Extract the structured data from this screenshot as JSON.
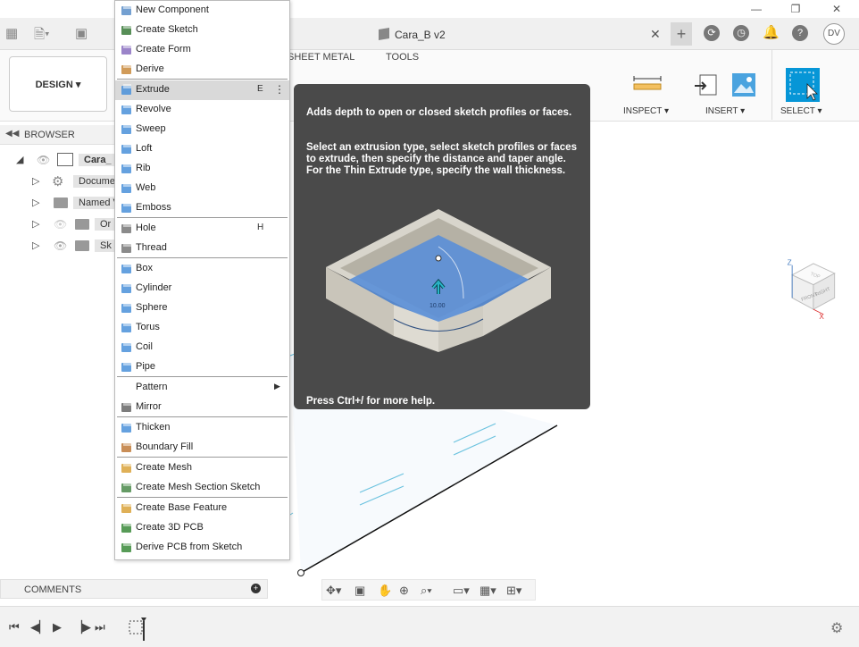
{
  "window": {
    "controls": [
      "—",
      "❐",
      "✕"
    ]
  },
  "app_bar": {
    "document_title": "Cara_B v2",
    "user_initials": "DV",
    "close_tab": "✕"
  },
  "toolbar": {
    "workspace_label": "DESIGN ▾",
    "tabs": [
      "SHEET METAL",
      "TOOLS"
    ],
    "groups": {
      "inspect": "INSPECT ▾",
      "insert": "INSERT ▾",
      "select": "SELECT ▾"
    }
  },
  "browser": {
    "title": "BROWSER",
    "items": [
      {
        "label": "Cara_",
        "expanded": true
      },
      {
        "label": "Docume"
      },
      {
        "label": "Named V"
      },
      {
        "label": "Or"
      },
      {
        "label": "Sk"
      }
    ]
  },
  "comments": {
    "title": "COMMENTS"
  },
  "menu": {
    "items": [
      {
        "label": "New Component",
        "icon": "new-component-icon"
      },
      {
        "label": "Create Sketch",
        "icon": "create-sketch-icon"
      },
      {
        "label": "Create Form",
        "icon": "create-form-icon"
      },
      {
        "label": "Derive",
        "icon": "derive-icon"
      },
      {
        "label": "Extrude",
        "icon": "extrude-icon",
        "shortcut": "E",
        "active": true
      },
      {
        "label": "Revolve",
        "icon": "revolve-icon"
      },
      {
        "label": "Sweep",
        "icon": "sweep-icon"
      },
      {
        "label": "Loft",
        "icon": "loft-icon"
      },
      {
        "label": "Rib",
        "icon": "rib-icon"
      },
      {
        "label": "Web",
        "icon": "web-icon"
      },
      {
        "label": "Emboss",
        "icon": "emboss-icon"
      },
      {
        "label": "Hole",
        "icon": "hole-icon",
        "shortcut": "H"
      },
      {
        "label": "Thread",
        "icon": "thread-icon"
      },
      {
        "label": "Box",
        "icon": "box-icon"
      },
      {
        "label": "Cylinder",
        "icon": "cylinder-icon"
      },
      {
        "label": "Sphere",
        "icon": "sphere-icon"
      },
      {
        "label": "Torus",
        "icon": "torus-icon"
      },
      {
        "label": "Coil",
        "icon": "coil-icon"
      },
      {
        "label": "Pipe",
        "icon": "pipe-icon"
      },
      {
        "label": "Pattern",
        "icon": "",
        "submenu": true
      },
      {
        "label": "Mirror",
        "icon": "mirror-icon"
      },
      {
        "label": "Thicken",
        "icon": "thicken-icon"
      },
      {
        "label": "Boundary Fill",
        "icon": "boundary-fill-icon"
      },
      {
        "label": "Create Mesh",
        "icon": "create-mesh-icon"
      },
      {
        "label": "Create Mesh Section Sketch",
        "icon": "mesh-section-sketch-icon"
      },
      {
        "label": "Create Base Feature",
        "icon": "base-feature-icon"
      },
      {
        "label": "Create 3D PCB",
        "icon": "pcb-3d-icon"
      },
      {
        "label": "Derive PCB from Sketch",
        "icon": "derive-pcb-icon"
      }
    ]
  },
  "tooltip": {
    "line1": "Adds depth to open or closed sketch profiles or faces.",
    "line2": "Select an extrusion type, select sketch profiles or faces to extrude, then specify the distance and taper angle. For the Thin Extrude type, specify the wall thickness.",
    "dimension": "10.00",
    "help": "Press Ctrl+/ for more help."
  },
  "viewcube": {
    "top": "TOP",
    "front": "FRONT",
    "right": "RIGHT",
    "axis_z": "Z",
    "axis_x": "X"
  },
  "colors": {
    "accent": "#0696d7",
    "tooltip_bg": "#4a4a4a",
    "menu_highlight": "#d9d9d9"
  }
}
